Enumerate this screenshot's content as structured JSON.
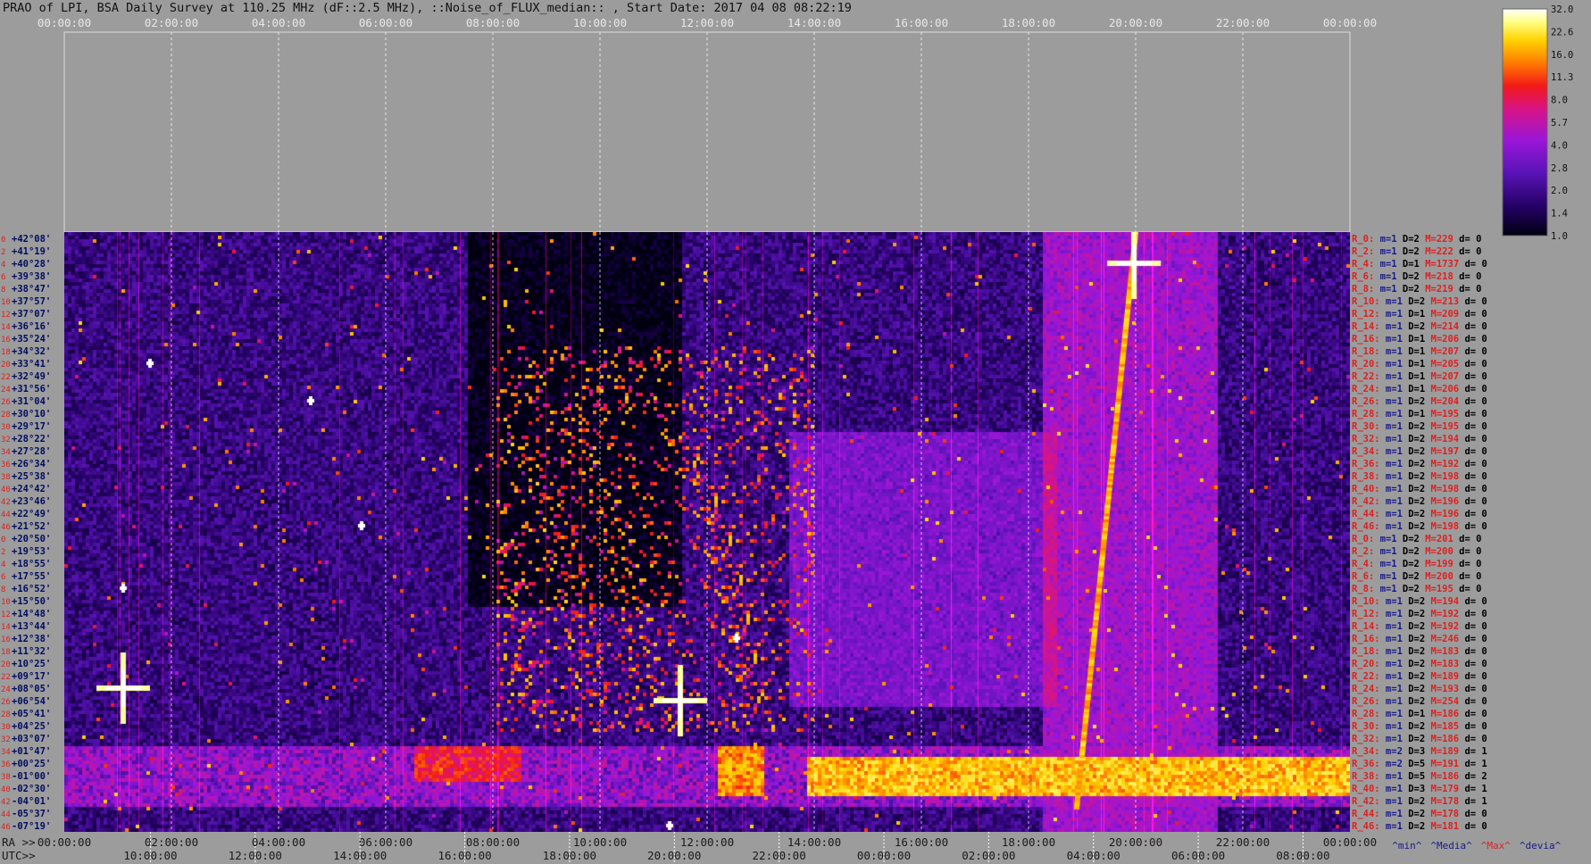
{
  "title": "PRAO of LPI, BSA Daily Survey at 110.25 MHz (dF::2.5 MHz), ::Noise_of_FLUX_median:: , Start Date: 2017 04 08 08:22:19",
  "top_axis_ticks": [
    "00:00:00",
    "02:00:00",
    "04:00:00",
    "06:00:00",
    "08:00:00",
    "10:00:00",
    "12:00:00",
    "14:00:00",
    "16:00:00",
    "18:00:00",
    "20:00:00",
    "22:00:00",
    "00:00:00"
  ],
  "ra_axis": {
    "prefix": "RA >>",
    "ticks": [
      "00:00:00",
      "02:00:00",
      "04:00:00",
      "06:00:00",
      "08:00:00",
      "10:00:00",
      "12:00:00",
      "14:00:00",
      "16:00:00",
      "18:00:00",
      "20:00:00",
      "22:00:00",
      "00:00:00"
    ]
  },
  "utc_axis": {
    "prefix": "UTC>>",
    "ticks": [
      "10:00:00",
      "12:00:00",
      "14:00:00",
      "16:00:00",
      "18:00:00",
      "20:00:00",
      "22:00:00",
      "00:00:00",
      "02:00:00",
      "04:00:00",
      "06:00:00",
      "08:00:00"
    ]
  },
  "legend_stats": [
    {
      "label": "^min^",
      "color": "#1a1a8c"
    },
    {
      "label": "^Media^",
      "color": "#1a1a8c"
    },
    {
      "label": "^Max^",
      "color": "#e02020"
    },
    {
      "label": "^devia^",
      "color": "#1a1a8c"
    }
  ],
  "colorbar": {
    "labels": [
      "32.0",
      "22.6",
      "16.0",
      "11.3",
      "8.0",
      "5.7",
      "4.0",
      "2.8",
      "2.0",
      "1.4",
      "1.0"
    ]
  },
  "chart_data": {
    "type": "heatmap",
    "x_axis_range": [
      "00:00:00",
      "24:00:00"
    ],
    "row_indices": [
      "0",
      "2",
      "4",
      "6",
      "8",
      "10",
      "12",
      "14",
      "16",
      "18",
      "20",
      "22",
      "24",
      "26",
      "28",
      "30",
      "32",
      "34",
      "36",
      "38",
      "40",
      "42",
      "44",
      "46",
      "0",
      "2",
      "4",
      "6",
      "8",
      "10",
      "12",
      "14",
      "16",
      "18",
      "20",
      "22",
      "24",
      "26",
      "28",
      "30",
      "32",
      "34",
      "36",
      "38",
      "40",
      "42",
      "44",
      "46"
    ],
    "declinations": [
      "+42°08'",
      "+41°19'",
      "+40°28'",
      "+39°38'",
      "+38°47'",
      "+37°57'",
      "+37°07'",
      "+36°16'",
      "+35°24'",
      "+34°32'",
      "+33°41'",
      "+32°49'",
      "+31°56'",
      "+31°04'",
      "+30°10'",
      "+29°17'",
      "+28°22'",
      "+27°28'",
      "+26°34'",
      "+25°38'",
      "+24°42'",
      "+23°46'",
      "+22°49'",
      "+21°52'",
      "+20°50'",
      "+19°53'",
      "+18°55'",
      "+17°55'",
      "+16°52'",
      "+15°50'",
      "+14°48'",
      "+13°44'",
      "+12°38'",
      "+11°32'",
      "+10°25'",
      "+09°17'",
      "+08°05'",
      "+06°54'",
      "+05°41'",
      "+04°25'",
      "+03°07'",
      "+01°47'",
      "+00°25'",
      "-01°00'",
      "-02°30'",
      "-04°01'",
      "-05°37'",
      "-07°19'"
    ],
    "row_stats": [
      {
        "r": "R_0:",
        "m": "m=1",
        "D": "D=2",
        "M": "M=229",
        "d": "d= 0"
      },
      {
        "r": "R_2:",
        "m": "m=1",
        "D": "D=2",
        "M": "M=222",
        "d": "d= 0"
      },
      {
        "r": "R_4:",
        "m": "m=1",
        "D": "D=1",
        "M": "M=1737",
        "d": "d= 0"
      },
      {
        "r": "R_6:",
        "m": "m=1",
        "D": "D=2",
        "M": "M=218",
        "d": "d= 0"
      },
      {
        "r": "R_8:",
        "m": "m=1",
        "D": "D=2",
        "M": "M=219",
        "d": "d= 0"
      },
      {
        "r": "R_10:",
        "m": "m=1",
        "D": "D=2",
        "M": "M=213",
        "d": "d= 0"
      },
      {
        "r": "R_12:",
        "m": "m=1",
        "D": "D=1",
        "M": "M=209",
        "d": "d= 0"
      },
      {
        "r": "R_14:",
        "m": "m=1",
        "D": "D=2",
        "M": "M=214",
        "d": "d= 0"
      },
      {
        "r": "R_16:",
        "m": "m=1",
        "D": "D=1",
        "M": "M=206",
        "d": "d= 0"
      },
      {
        "r": "R_18:",
        "m": "m=1",
        "D": "D=1",
        "M": "M=207",
        "d": "d= 0"
      },
      {
        "r": "R_20:",
        "m": "m=1",
        "D": "D=1",
        "M": "M=205",
        "d": "d= 0"
      },
      {
        "r": "R_22:",
        "m": "m=1",
        "D": "D=1",
        "M": "M=207",
        "d": "d= 0"
      },
      {
        "r": "R_24:",
        "m": "m=1",
        "D": "D=1",
        "M": "M=206",
        "d": "d= 0"
      },
      {
        "r": "R_26:",
        "m": "m=1",
        "D": "D=2",
        "M": "M=204",
        "d": "d= 0"
      },
      {
        "r": "R_28:",
        "m": "m=1",
        "D": "D=1",
        "M": "M=195",
        "d": "d= 0"
      },
      {
        "r": "R_30:",
        "m": "m=1",
        "D": "D=2",
        "M": "M=195",
        "d": "d= 0"
      },
      {
        "r": "R_32:",
        "m": "m=1",
        "D": "D=2",
        "M": "M=194",
        "d": "d= 0"
      },
      {
        "r": "R_34:",
        "m": "m=1",
        "D": "D=2",
        "M": "M=197",
        "d": "d= 0"
      },
      {
        "r": "R_36:",
        "m": "m=1",
        "D": "D=2",
        "M": "M=192",
        "d": "d= 0"
      },
      {
        "r": "R_38:",
        "m": "m=1",
        "D": "D=2",
        "M": "M=198",
        "d": "d= 0"
      },
      {
        "r": "R_40:",
        "m": "m=1",
        "D": "D=2",
        "M": "M=198",
        "d": "d= 0"
      },
      {
        "r": "R_42:",
        "m": "m=1",
        "D": "D=2",
        "M": "M=196",
        "d": "d= 0"
      },
      {
        "r": "R_44:",
        "m": "m=1",
        "D": "D=2",
        "M": "M=196",
        "d": "d= 0"
      },
      {
        "r": "R_46:",
        "m": "m=1",
        "D": "D=2",
        "M": "M=198",
        "d": "d= 0"
      },
      {
        "r": "R_0:",
        "m": "m=1",
        "D": "D=2",
        "M": "M=201",
        "d": "d= 0"
      },
      {
        "r": "R_2:",
        "m": "m=1",
        "D": "D=2",
        "M": "M=200",
        "d": "d= 0"
      },
      {
        "r": "R_4:",
        "m": "m=1",
        "D": "D=2",
        "M": "M=199",
        "d": "d= 0"
      },
      {
        "r": "R_6:",
        "m": "m=1",
        "D": "D=2",
        "M": "M=200",
        "d": "d= 0"
      },
      {
        "r": "R_8:",
        "m": "m=1",
        "D": "D=2",
        "M": "M=195",
        "d": "d= 0"
      },
      {
        "r": "R_10:",
        "m": "m=1",
        "D": "D=2",
        "M": "M=194",
        "d": "d= 0"
      },
      {
        "r": "R_12:",
        "m": "m=1",
        "D": "D=2",
        "M": "M=192",
        "d": "d= 0"
      },
      {
        "r": "R_14:",
        "m": "m=1",
        "D": "D=2",
        "M": "M=192",
        "d": "d= 0"
      },
      {
        "r": "R_16:",
        "m": "m=1",
        "D": "D=2",
        "M": "M=246",
        "d": "d= 0"
      },
      {
        "r": "R_18:",
        "m": "m=1",
        "D": "D=2",
        "M": "M=183",
        "d": "d= 0"
      },
      {
        "r": "R_20:",
        "m": "m=1",
        "D": "D=2",
        "M": "M=183",
        "d": "d= 0"
      },
      {
        "r": "R_22:",
        "m": "m=1",
        "D": "D=2",
        "M": "M=189",
        "d": "d= 0"
      },
      {
        "r": "R_24:",
        "m": "m=1",
        "D": "D=2",
        "M": "M=193",
        "d": "d= 0"
      },
      {
        "r": "R_26:",
        "m": "m=1",
        "D": "D=2",
        "M": "M=254",
        "d": "d= 0"
      },
      {
        "r": "R_28:",
        "m": "m=1",
        "D": "D=1",
        "M": "M=186",
        "d": "d= 0"
      },
      {
        "r": "R_30:",
        "m": "m=1",
        "D": "D=2",
        "M": "M=185",
        "d": "d= 0"
      },
      {
        "r": "R_32:",
        "m": "m=1",
        "D": "D=2",
        "M": "M=186",
        "d": "d= 0"
      },
      {
        "r": "R_34:",
        "m": "m=2",
        "D": "D=3",
        "M": "M=189",
        "d": "d= 1"
      },
      {
        "r": "R_36:",
        "m": "m=2",
        "D": "D=5",
        "M": "M=191",
        "d": "d= 1"
      },
      {
        "r": "R_38:",
        "m": "m=1",
        "D": "D=5",
        "M": "M=186",
        "d": "d= 2"
      },
      {
        "r": "R_40:",
        "m": "m=1",
        "D": "D=3",
        "M": "M=179",
        "d": "d= 1"
      },
      {
        "r": "R_42:",
        "m": "m=1",
        "D": "D=2",
        "M": "M=178",
        "d": "d= 1"
      },
      {
        "r": "R_44:",
        "m": "m=1",
        "D": "D=2",
        "M": "M=178",
        "d": "d= 0"
      },
      {
        "r": "R_46:",
        "m": "m=1",
        "D": "D=2",
        "M": "M=181",
        "d": "d= 0"
      }
    ],
    "features": [
      {
        "type": "source",
        "ra_hours": 19.97,
        "row": 2,
        "intensity": 32
      },
      {
        "type": "source",
        "ra_hours": 11.5,
        "row": 37,
        "intensity": 32
      },
      {
        "type": "source",
        "ra_hours": 1.1,
        "row": 36,
        "intensity": 32
      },
      {
        "type": "source",
        "ra_hours": 12.55,
        "row": 32,
        "intensity": 22
      },
      {
        "type": "source",
        "ra_hours": 5.55,
        "row": 23,
        "intensity": 22
      },
      {
        "type": "source",
        "ra_hours": 1.1,
        "row": 28,
        "intensity": 16
      },
      {
        "type": "source",
        "ra_hours": 1.6,
        "row": 10,
        "intensity": 16
      },
      {
        "type": "source",
        "ra_hours": 4.6,
        "row": 13,
        "intensity": 12
      },
      {
        "type": "source",
        "ra_hours": 11.3,
        "row": 47,
        "intensity": 22
      },
      {
        "type": "track",
        "ra_start": 18.9,
        "ra_end": 20.0,
        "row_start": 46,
        "row_end": 0,
        "intensity": 11
      },
      {
        "type": "band",
        "row_start": 41,
        "row_end": 45,
        "ra_start": 0.0,
        "ra_end": 24.0,
        "intensity": 3
      },
      {
        "type": "band",
        "row_start": 42,
        "row_end": 44,
        "ra_start": 13.8,
        "ra_end": 24.0,
        "intensity": 12
      },
      {
        "type": "band",
        "row_start": 41,
        "row_end": 43,
        "ra_start": 6.5,
        "ra_end": 8.5,
        "intensity": 6
      },
      {
        "type": "band",
        "row_start": 41,
        "row_end": 44,
        "ra_start": 12.2,
        "ra_end": 13.0,
        "intensity": 10
      },
      {
        "type": "column",
        "ra_hours": 18.0,
        "row_start": 0,
        "row_end": 47,
        "intensity": 3
      },
      {
        "type": "column",
        "ra_hours": 19.9,
        "row_start": 0,
        "row_end": 47,
        "intensity": 5
      }
    ]
  }
}
